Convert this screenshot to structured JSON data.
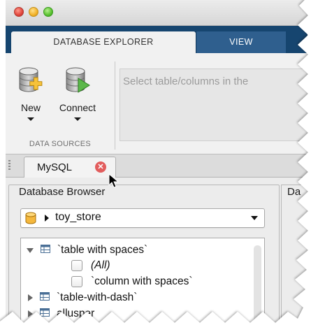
{
  "ribbon": {
    "tab_database_explorer": "DATABASE EXPLORER",
    "tab_view": "VIEW"
  },
  "toolstrip": {
    "new_label": "New",
    "connect_label": "Connect",
    "section_label": "DATA SOURCES",
    "prompt_text": "Select table/columns in the"
  },
  "doc_tab": {
    "label": "MySQL",
    "close_glyph": "✕"
  },
  "browser": {
    "title": "Database Browser",
    "selected_source": "toy_store",
    "tree": [
      {
        "label": "`table with spaces`",
        "kind": "table",
        "expanded": true
      },
      {
        "label": "(All)",
        "kind": "column",
        "checked": false
      },
      {
        "label": "`column with spaces`",
        "kind": "column",
        "checked": false
      },
      {
        "label": "`table-with-dash`",
        "kind": "table",
        "expanded": false
      },
      {
        "label": "allusper",
        "kind": "table",
        "expanded": false
      }
    ]
  },
  "right_panel": {
    "title": "Da"
  },
  "colors": {
    "ribbon_dark": "#16456f",
    "view_tab": "#2f5f8e",
    "close_red": "#e25d5d"
  },
  "icons": [
    "close-window-icon",
    "minimize-window-icon",
    "zoom-window-icon",
    "new-database-icon",
    "connect-database-icon",
    "tab-close-icon",
    "mouse-pointer-icon",
    "database-icon",
    "table-icon"
  ]
}
